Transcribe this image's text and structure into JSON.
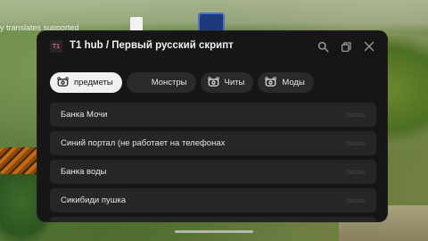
{
  "background": {
    "translate_note": "y translates supported"
  },
  "window": {
    "title": "T1 hub / Первый русский скрипт",
    "logo_text": "T1",
    "icons": [
      "search-icon",
      "minimize-icon",
      "close-icon"
    ],
    "tabs": [
      {
        "label": "предметы",
        "icon": "gamepad-icon",
        "active": true
      },
      {
        "label": "Монстры",
        "icon": "",
        "active": false
      },
      {
        "label": "Читы",
        "icon": "gamepad-icon",
        "active": false
      },
      {
        "label": "Моды",
        "icon": "gamepad-icon",
        "active": false
      }
    ],
    "items": [
      {
        "label": "Банка Мочи",
        "hint": "button"
      },
      {
        "label": "Синий портал (не работает на телефонах",
        "hint": "button"
      },
      {
        "label": "Банка воды",
        "hint": "button"
      },
      {
        "label": "Сикибиди пушка",
        "hint": "button"
      }
    ]
  },
  "colors": {
    "window_bg": "#161616",
    "item_bg": "#262626",
    "tab_active_bg": "#f0f0f0"
  }
}
